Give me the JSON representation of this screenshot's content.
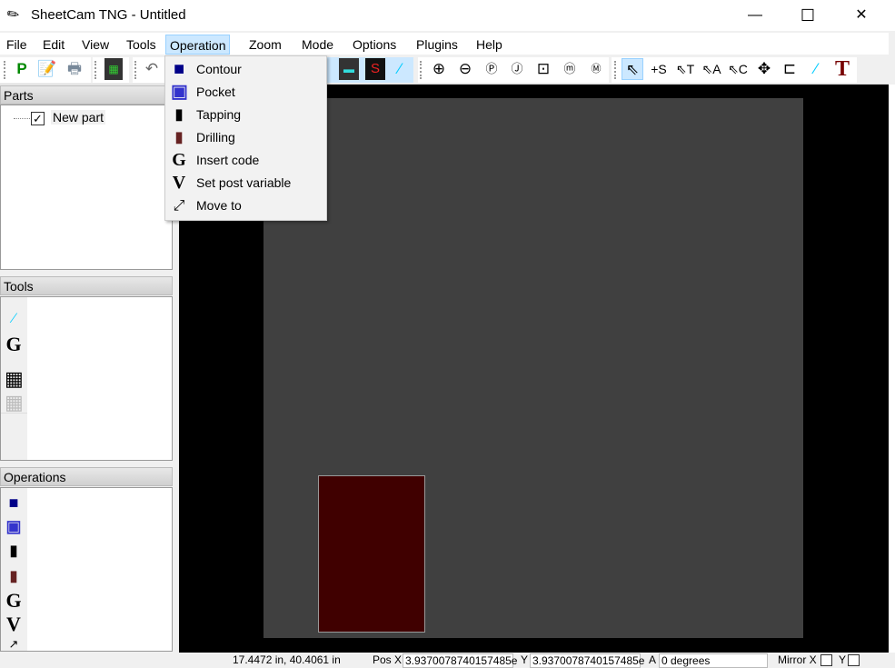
{
  "window": {
    "title": "SheetCam TNG - Untitled",
    "minimize": "—",
    "maximize": "☐",
    "close": "✕"
  },
  "menu": [
    "File",
    "Edit",
    "View",
    "Tools",
    "Operation",
    "Zoom",
    "Mode",
    "Options",
    "Plugins",
    "Help"
  ],
  "operation_menu": [
    {
      "label": "Contour",
      "icon": "contour-icon"
    },
    {
      "label": "Pocket",
      "icon": "pocket-icon"
    },
    {
      "label": "Tapping",
      "icon": "tapping-icon"
    },
    {
      "label": "Drilling",
      "icon": "drilling-icon"
    },
    {
      "label": "Insert code",
      "icon": "G"
    },
    {
      "label": "Set post variable",
      "icon": "V"
    },
    {
      "label": "Move to",
      "icon": "move-to-icon"
    }
  ],
  "toolbar": {
    "post": "P",
    "s_label": "S",
    "sel_labels": [
      "S",
      "T",
      "A",
      "C"
    ],
    "text_tool": "T"
  },
  "panels": {
    "parts": {
      "title": "Parts",
      "items": [
        {
          "label": "New part",
          "checked": true
        }
      ]
    },
    "tools": {
      "title": "Tools"
    },
    "operations": {
      "title": "Operations"
    }
  },
  "status": {
    "cursor": "17.4472 in, 40.4061 in",
    "pos_x_label": "Pos X",
    "pos_x": "3.9370078740157485e",
    "y_label": "Y",
    "pos_y": "3.9370078740157485e",
    "a_label": "A",
    "angle": "0 degrees",
    "mirror_x_label": "Mirror X",
    "mirror_y_label": "Y"
  },
  "colors": {
    "canvas": "#000000",
    "sheet": "#404040",
    "part": "#400000",
    "menu_highlight": "#cce8ff"
  }
}
